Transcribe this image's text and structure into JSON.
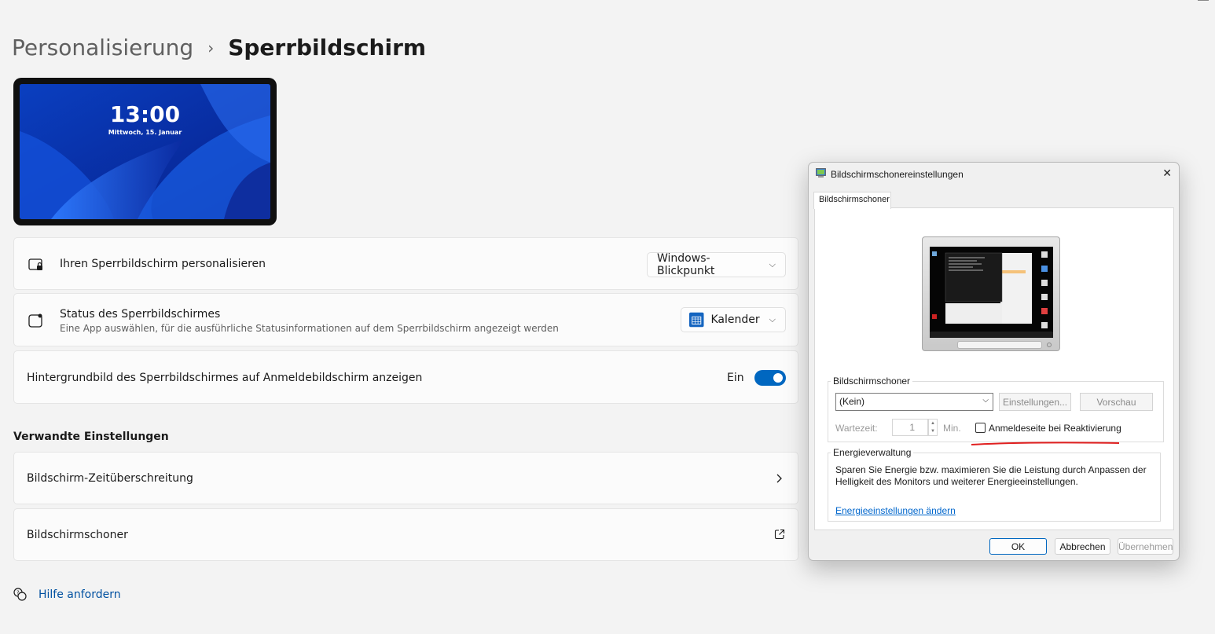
{
  "breadcrumb": {
    "parent": "Personalisierung",
    "separator": "›",
    "current": "Sperrbildschirm"
  },
  "lock_preview": {
    "time": "13:00",
    "date": "Mittwoch, 15. Januar"
  },
  "settings": {
    "personalize": {
      "label": "Ihren Sperrbildschirm personalisieren",
      "value": "Windows-Blickpunkt"
    },
    "status": {
      "label": "Status des Sperrbildschirmes",
      "description": "Eine App auswählen, für die ausführliche Statusinformationen auf dem Sperrbildschirm angezeigt werden",
      "value": "Kalender"
    },
    "background_signin": {
      "label": "Hintergrundbild des Sperrbildschirmes auf Anmeldebildschirm anzeigen",
      "state": "Ein"
    }
  },
  "related": {
    "title": "Verwandte Einstellungen",
    "timeout": "Bildschirm-Zeitüberschreitung",
    "screensaver": "Bildschirmschoner"
  },
  "help": "Hilfe anfordern",
  "dialog": {
    "title": "Bildschirmschonereinstellungen",
    "tab": "Bildschirmschoner",
    "group_screensaver": "Bildschirmschoner",
    "select_value": "(Kein)",
    "settings_button": "Einstellungen...",
    "preview_button": "Vorschau",
    "wait_label": "Wartezeit:",
    "wait_value": "1",
    "wait_unit": "Min.",
    "resume_checkbox": "Anmeldeseite bei Reaktivierung",
    "group_energy": "Energieverwaltung",
    "energy_text": "Sparen Sie Energie bzw. maximieren Sie die Leistung durch Anpassen der Helligkeit des Monitors und weiterer Energieeinstellungen.",
    "energy_link": "Energieeinstellungen ändern",
    "ok": "OK",
    "cancel": "Abbrechen",
    "apply": "Übernehmen"
  },
  "colors": {
    "accent": "#0067c0",
    "annotation": "#e02020"
  }
}
